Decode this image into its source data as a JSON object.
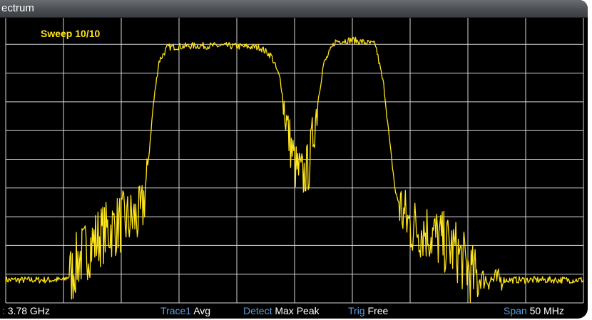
{
  "window": {
    "title": "ectrum"
  },
  "overlay": {
    "sweep_label": "Sweep",
    "sweep_value": "10/10"
  },
  "status": {
    "center_key": ":",
    "center_value": "3.78 GHz",
    "trace_key": "Trace1",
    "trace_value": "Avg",
    "detect_key": "Detect",
    "detect_value": "Max Peak",
    "trig_key": "Trig",
    "trig_value": "Free",
    "span_key": "Span",
    "span_value": "50 MHz"
  },
  "colors": {
    "trace": "#ffe51a",
    "grid": "#d8d8d8",
    "status_key": "#5b9fe0",
    "background": "#000000"
  },
  "chart_data": {
    "type": "line",
    "title": "",
    "xlabel": "",
    "ylabel": "",
    "grid": true,
    "grid_divisions": {
      "x": 10,
      "y": 10
    },
    "xlim": [
      0,
      100
    ],
    "ylim": [
      0,
      100
    ],
    "series": [
      {
        "x": [
          0,
          5,
          10,
          11.5,
          12.5,
          16,
          20,
          23.5,
          24.5,
          25.5,
          26.5,
          28,
          32,
          38,
          44,
          46,
          47.5,
          49,
          50.2,
          51.5,
          52.5,
          53.5,
          55,
          57,
          60,
          64,
          65.5,
          66.5,
          67.5,
          69,
          70,
          73,
          78,
          81,
          84,
          90,
          95,
          100
        ],
        "values": [
          8,
          8,
          8,
          10,
          15,
          23,
          28,
          30,
          45,
          68,
          84,
          89,
          89.5,
          89.5,
          89,
          86,
          78,
          58,
          47,
          44,
          48,
          63,
          83,
          91,
          91.5,
          90,
          75,
          55,
          38,
          30,
          27,
          25,
          18,
          9,
          8,
          8,
          8,
          8
        ]
      }
    ]
  }
}
